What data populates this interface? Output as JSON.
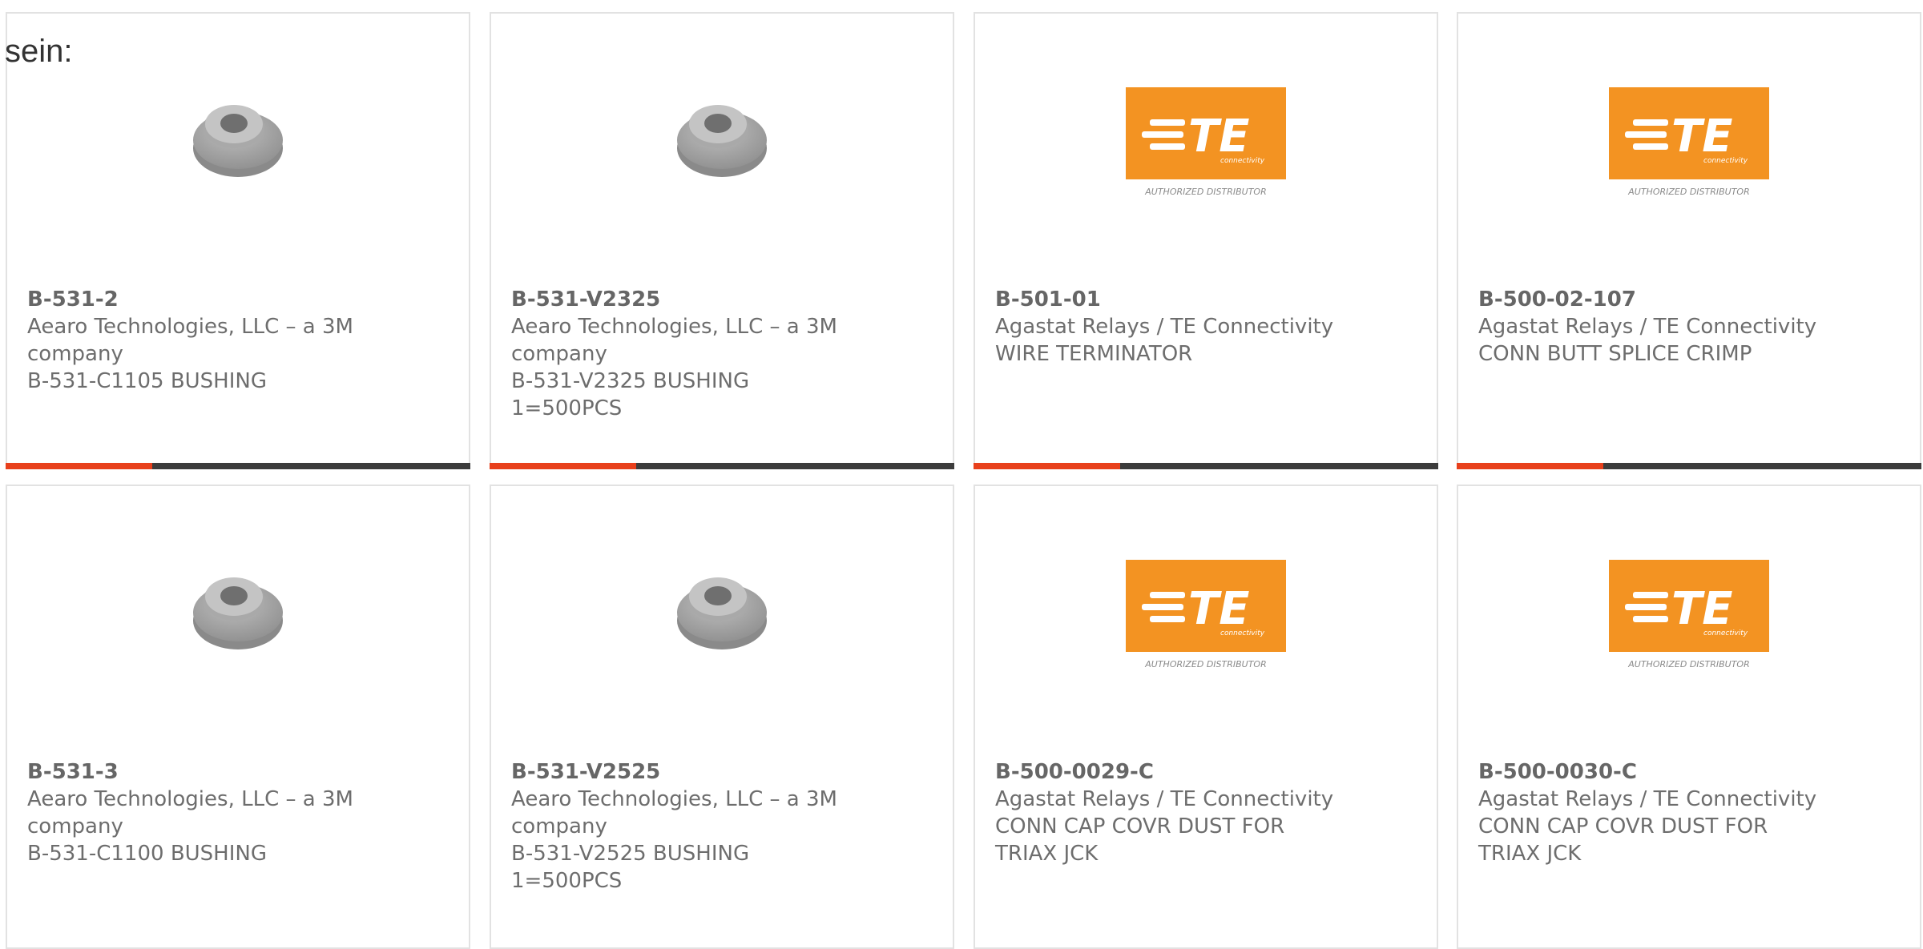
{
  "intro_text": "sein:",
  "colors": {
    "accent": "#e8401c",
    "bar_dark": "#3c3c3c",
    "te_orange": "#f39322"
  },
  "cards": [
    {
      "part": "B-531-2",
      "manufacturer_1": "Aearo Technologies, LLC – a 3M",
      "manufacturer_2": "company",
      "desc_1": "B-531-C1105 BUSHING",
      "desc_2": "",
      "image": "bushing-image"
    },
    {
      "part": "B-531-V2325",
      "manufacturer_1": "Aearo Technologies, LLC – a 3M",
      "manufacturer_2": "company",
      "desc_1": "B-531-V2325 BUSHING",
      "desc_2": "1=500PCS",
      "image": "bushing-image"
    },
    {
      "part": "B-501-01",
      "manufacturer_1": "Agastat Relays / TE Connectivity",
      "manufacturer_2": "",
      "desc_1": "WIRE TERMINATOR",
      "desc_2": "",
      "image": "te-logo",
      "logo_text": "TE",
      "logo_sub": "connectivity",
      "logo_caption": "AUTHORIZED DISTRIBUTOR"
    },
    {
      "part": "B-500-02-107",
      "manufacturer_1": "Agastat Relays / TE Connectivity",
      "manufacturer_2": "",
      "desc_1": "CONN BUTT SPLICE CRIMP",
      "desc_2": "",
      "image": "te-logo",
      "logo_text": "TE",
      "logo_sub": "connectivity",
      "logo_caption": "AUTHORIZED DISTRIBUTOR"
    },
    {
      "part": "B-531-3",
      "manufacturer_1": "Aearo Technologies, LLC – a 3M",
      "manufacturer_2": "company",
      "desc_1": "B-531-C1100 BUSHING",
      "desc_2": "",
      "image": "bushing-image"
    },
    {
      "part": "B-531-V2525",
      "manufacturer_1": "Aearo Technologies, LLC – a 3M",
      "manufacturer_2": "company",
      "desc_1": "B-531-V2525 BUSHING",
      "desc_2": "1=500PCS",
      "image": "bushing-image"
    },
    {
      "part": "B-500-0029-C",
      "manufacturer_1": "Agastat Relays / TE Connectivity",
      "manufacturer_2": "",
      "desc_1": "CONN CAP COVR DUST FOR",
      "desc_2": "TRIAX JCK",
      "image": "te-logo",
      "logo_text": "TE",
      "logo_sub": "connectivity",
      "logo_caption": "AUTHORIZED DISTRIBUTOR"
    },
    {
      "part": "B-500-0030-C",
      "manufacturer_1": "Agastat Relays / TE Connectivity",
      "manufacturer_2": "",
      "desc_1": "CONN CAP COVR DUST FOR",
      "desc_2": "TRIAX JCK",
      "image": "te-logo",
      "logo_text": "TE",
      "logo_sub": "connectivity",
      "logo_caption": "AUTHORIZED DISTRIBUTOR"
    }
  ]
}
